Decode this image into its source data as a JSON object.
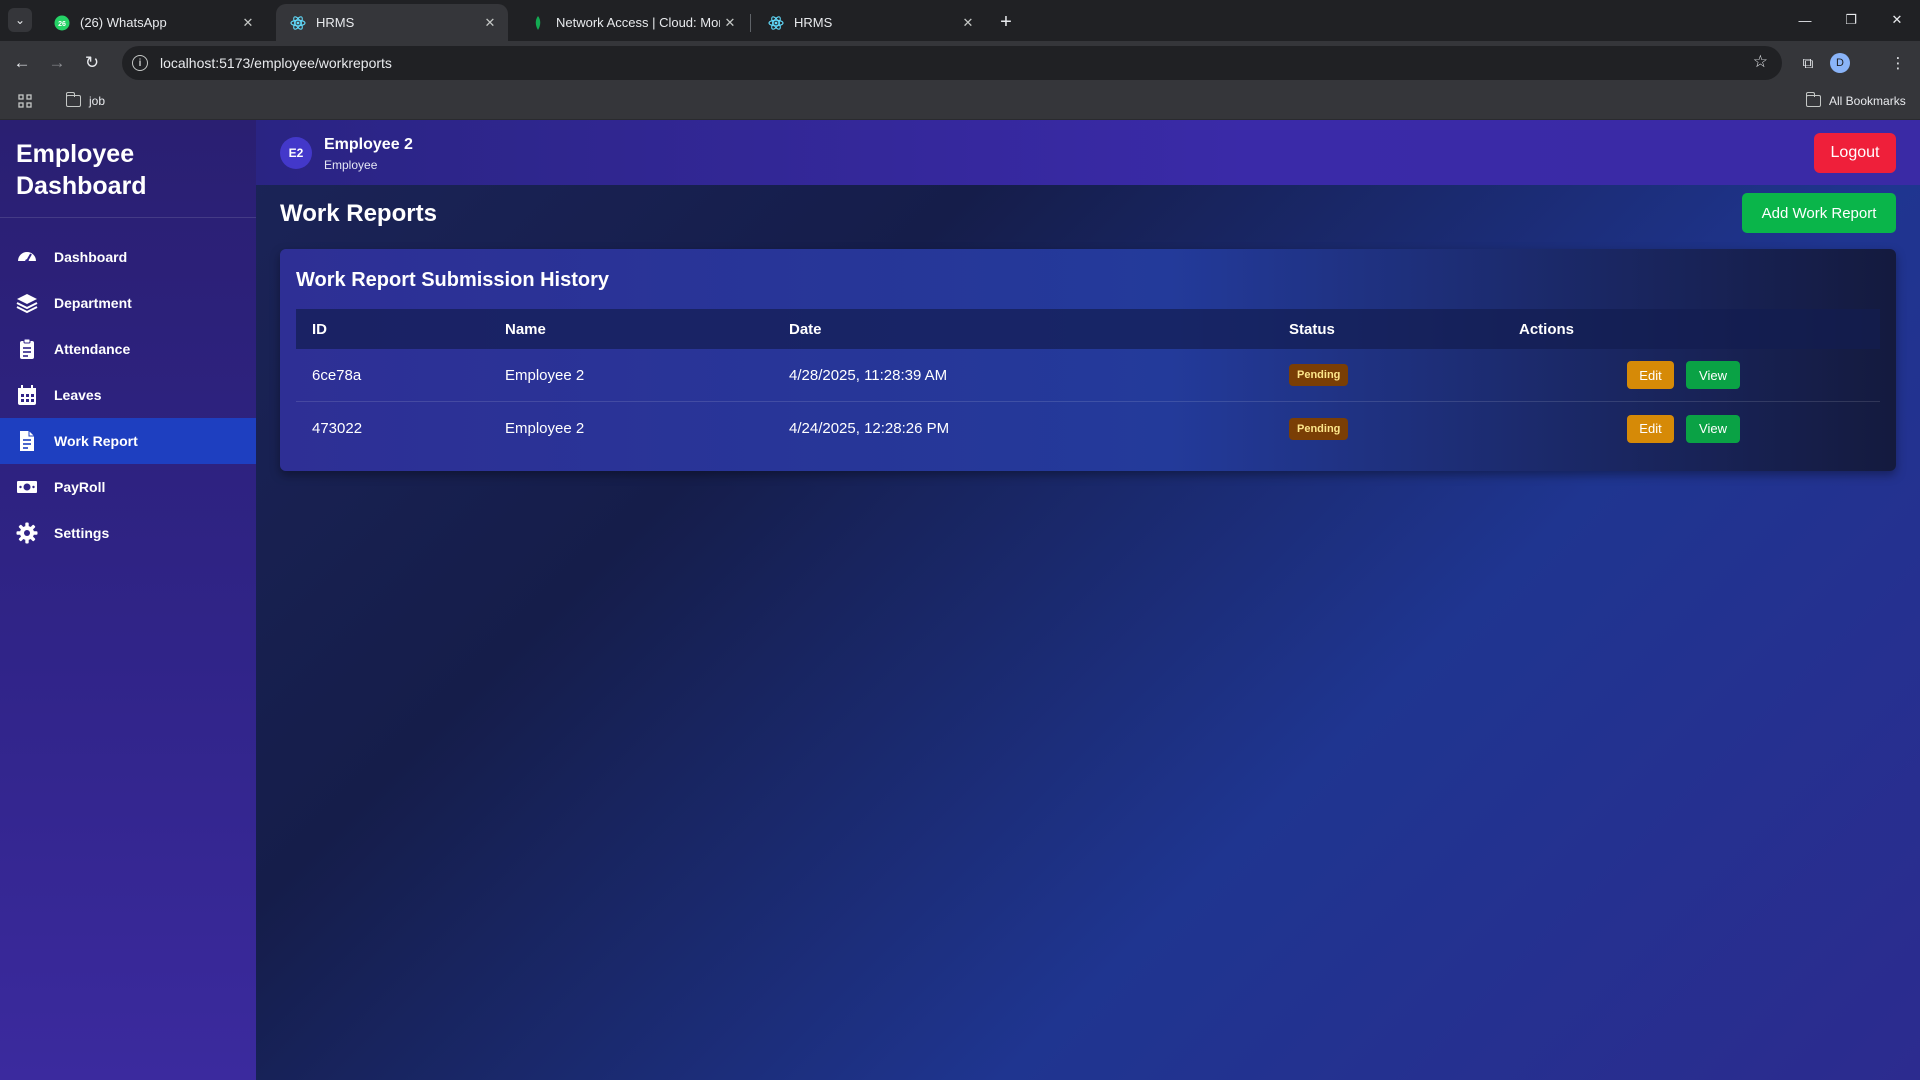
{
  "browser": {
    "tabs": [
      {
        "title": "(26) WhatsApp",
        "icon": "whatsapp-icon",
        "active": false
      },
      {
        "title": "HRMS",
        "icon": "react-icon",
        "active": true
      },
      {
        "title": "Network Access | Cloud: Mongo",
        "icon": "mongodb-leaf-icon",
        "active": false
      },
      {
        "title": "HRMS",
        "icon": "react-icon",
        "active": false
      }
    ],
    "url": "localhost:5173/employee/workreports",
    "profile_initial": "D",
    "bookmarks": {
      "folder": "job",
      "all_bookmarks": "All Bookmarks"
    }
  },
  "sidebar": {
    "title": "Employee Dashboard",
    "items": [
      {
        "label": "Dashboard",
        "icon": "speedometer-icon",
        "active": false
      },
      {
        "label": "Department",
        "icon": "layers-icon",
        "active": false
      },
      {
        "label": "Attendance",
        "icon": "clipboard-icon",
        "active": false
      },
      {
        "label": "Leaves",
        "icon": "calendar-icon",
        "active": false
      },
      {
        "label": "Work Report",
        "icon": "document-icon",
        "active": true
      },
      {
        "label": "PayRoll",
        "icon": "money-icon",
        "active": false
      },
      {
        "label": "Settings",
        "icon": "gear-icon",
        "active": false
      }
    ]
  },
  "header": {
    "avatar_initials": "E2",
    "user_name": "Employee 2",
    "user_role": "Employee",
    "logout_label": "Logout"
  },
  "page": {
    "title": "Work Reports",
    "add_button_label": "Add Work Report"
  },
  "history": {
    "title": "Work Report Submission History",
    "columns": [
      "ID",
      "Name",
      "Date",
      "Status",
      "Actions"
    ],
    "rows": [
      {
        "id": "6ce78a",
        "name": "Employee 2",
        "date": "4/28/2025, 11:28:39 AM",
        "status": "Pending",
        "edit": "Edit",
        "view": "View"
      },
      {
        "id": "473022",
        "name": "Employee 2",
        "date": "4/24/2025, 12:28:26 PM",
        "status": "Pending",
        "edit": "Edit",
        "view": "View"
      }
    ]
  },
  "colors": {
    "logout": "#ef1f3a",
    "add_button": "#0ab54a",
    "edit_button": "#d68a07",
    "view_button": "#0aa245",
    "pending_badge": "#7a3e05",
    "active_nav": "#1e3fc0"
  }
}
